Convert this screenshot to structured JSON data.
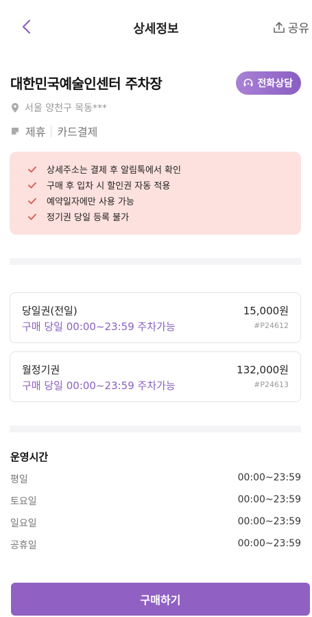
{
  "header": {
    "title": "상세정보",
    "share_label": "공유"
  },
  "lot": {
    "name": "대한민국예술인센터 주차장",
    "call_label": "전화상담",
    "address": "서울 양천구 목동***",
    "tags": [
      "제휴",
      "카드결제"
    ]
  },
  "notices": [
    "상세주소는 결제 후 알림톡에서 확인",
    "구매 후 입차 시 할인권 자동 적용",
    "예약일자에만 사용 가능",
    "정기권 당일 등록 불가"
  ],
  "tickets": [
    {
      "name": "당일권(전일)",
      "price": "15,000원",
      "time": "구매 당일 00:00~23:59 주차가능",
      "code": "#P24612"
    },
    {
      "name": "월정기권",
      "price": "132,000원",
      "time": "구매 당일 00:00~23:59 주차가능",
      "code": "#P24613"
    }
  ],
  "hours": {
    "title": "운영시간",
    "rows": [
      {
        "day": "평일",
        "time": "00:00~23:59"
      },
      {
        "day": "토요일",
        "time": "00:00~23:59"
      },
      {
        "day": "일요일",
        "time": "00:00~23:59"
      },
      {
        "day": "공휴일",
        "time": "00:00~23:59"
      }
    ]
  },
  "buy_label": "구매하기",
  "colors": {
    "accent": "#9061c2",
    "notice_bg": "#fce1de",
    "check": "#e0564a"
  }
}
